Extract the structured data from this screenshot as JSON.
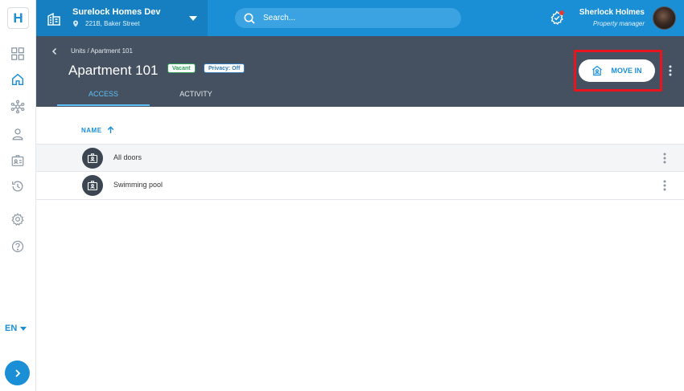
{
  "app": {
    "logo_letter": "H"
  },
  "site": {
    "name": "Surelock Homes Dev",
    "address": "221B, Baker Street"
  },
  "search": {
    "placeholder": "Search..."
  },
  "user": {
    "name": "Sherlock Holmes",
    "role": "Property manager"
  },
  "language": {
    "code": "EN"
  },
  "page": {
    "breadcrumb": "Units / Apartment 101",
    "title": "Apartment 101",
    "badges": [
      "Vacant",
      "Privacy: Off"
    ],
    "move_in_label": "MOVE IN",
    "tabs": [
      {
        "label": "ACCESS",
        "active": true
      },
      {
        "label": "ACTIVITY",
        "active": false
      }
    ]
  },
  "access_table": {
    "column_header": "NAME",
    "rows": [
      {
        "name": "All doors"
      },
      {
        "name": "Swimming pool"
      }
    ]
  },
  "colors": {
    "primary": "#1a8fd6",
    "header_bg": "#455160",
    "highlight": "#e8141e",
    "vacant": "#2e9e55",
    "privacy": "#357ab8"
  },
  "icons": [
    "dashboard-icon",
    "home-icon",
    "network-icon",
    "user-icon",
    "badge-icon",
    "history-icon",
    "settings-icon",
    "help-icon",
    "building-icon",
    "location-pin-icon",
    "search-icon",
    "notification-icon",
    "back-chevron-icon",
    "move-in-icon",
    "more-vertical-icon",
    "sort-arrow-up-icon",
    "access-card-icon",
    "chevron-right-icon"
  ]
}
